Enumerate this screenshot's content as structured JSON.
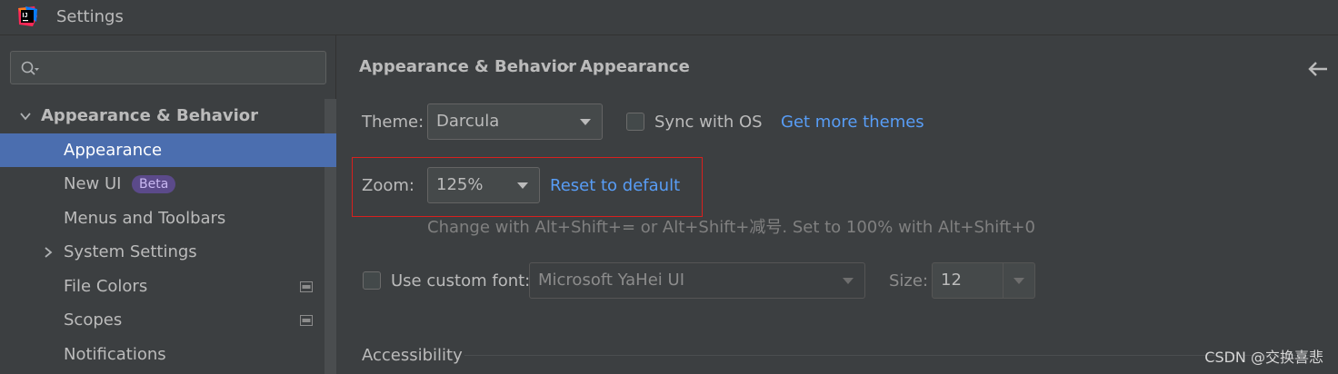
{
  "window": {
    "title": "Settings",
    "icon": "intellij-idea-icon"
  },
  "sidebar": {
    "search": {
      "placeholder": ""
    },
    "items": [
      {
        "label": "Appearance & Behavior",
        "expanded": true
      },
      {
        "label": "Appearance",
        "selected": true
      },
      {
        "label": "New UI",
        "badge": "Beta"
      },
      {
        "label": "Menus and Toolbars"
      },
      {
        "label": "System Settings",
        "collapsed": true
      },
      {
        "label": "File Colors"
      },
      {
        "label": "Scopes"
      },
      {
        "label": "Notifications"
      }
    ]
  },
  "breadcrumb": {
    "parent": "Appearance & Behavior",
    "separator": "›",
    "current": "Appearance"
  },
  "theme": {
    "label": "Theme:",
    "value": "Darcula",
    "sync_label": "Sync with OS",
    "sync_checked": false,
    "get_more_link": "Get more themes"
  },
  "zoom": {
    "label": "Zoom:",
    "value": "125%",
    "reset_link": "Reset to default",
    "hint": "Change with Alt+Shift+= or Alt+Shift+减号. Set to 100% with Alt+Shift+0"
  },
  "font": {
    "checkbox_label": "Use custom font:",
    "checked": false,
    "value": "Microsoft YaHei UI",
    "size_label": "Size:",
    "size_value": "12"
  },
  "accessibility": {
    "label": "Accessibility"
  },
  "watermark": "CSDN @交换喜悲",
  "colors": {
    "background": "#3c3f41",
    "selection": "#4b6eaf",
    "link": "#589df6",
    "highlight_box": "#d8201e",
    "beta_badge": "#5b4a8a"
  }
}
